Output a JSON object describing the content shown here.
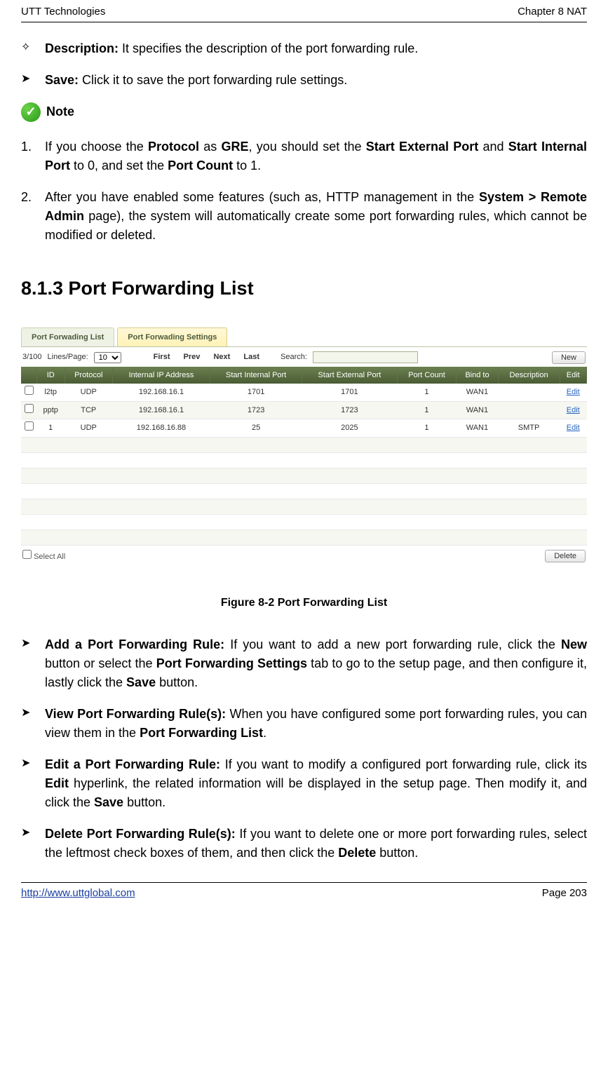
{
  "header": {
    "left": "UTT Technologies",
    "right": "Chapter 8 NAT"
  },
  "bullets_top": [
    {
      "sym": "✧",
      "label": "Description:",
      "text": " It specifies the description of the port forwarding rule."
    },
    {
      "sym": "➤",
      "label": "Save:",
      "text": " Click it to save the port forwarding rule settings."
    }
  ],
  "note": {
    "label": "Note"
  },
  "numbered": [
    {
      "n": "1.",
      "pre": "If you choose the ",
      "b1": "Protocol",
      "mid1": " as ",
      "b2": "GRE",
      "mid2": ", you should set the ",
      "b3": "Start External Port",
      "mid3": " and ",
      "b4": "Start Internal Port",
      "mid4": " to 0, and set the ",
      "b5": "Port Count",
      "post": " to 1."
    },
    {
      "n": "2.",
      "pre": "After you have enabled some features (such as, HTTP management in the ",
      "b1": "System > Remote Admin",
      "post": " page), the system will automatically create some port forwarding rules, which cannot be modified or deleted."
    }
  ],
  "section_heading": "8.1.3    Port Forwarding List",
  "shot": {
    "tabs": {
      "inactive": "Port Forwading List",
      "active": "Port Forwading Settings"
    },
    "toolbar": {
      "counter": "3/100",
      "lpp_label": "Lines/Page:",
      "lpp_value": "10",
      "first": "First",
      "prev": "Prev",
      "next": "Next",
      "last": "Last",
      "search_label": "Search:",
      "new_btn": "New"
    },
    "columns": {
      "ck": "",
      "id": "ID",
      "proto": "Protocol",
      "ip": "Internal IP Address",
      "sip": "Start Internal Port",
      "sep": "Start External Port",
      "pc": "Port Count",
      "bind": "Bind to",
      "desc": "Description",
      "edit": "Edit"
    },
    "rows": [
      {
        "id": "l2tp",
        "proto": "UDP",
        "ip": "192.168.16.1",
        "sip": "1701",
        "sep": "1701",
        "pc": "1",
        "bind": "WAN1",
        "desc": "",
        "edit": "Edit"
      },
      {
        "id": "pptp",
        "proto": "TCP",
        "ip": "192.168.16.1",
        "sip": "1723",
        "sep": "1723",
        "pc": "1",
        "bind": "WAN1",
        "desc": "",
        "edit": "Edit"
      },
      {
        "id": "1",
        "proto": "UDP",
        "ip": "192.168.16.88",
        "sip": "25",
        "sep": "2025",
        "pc": "1",
        "bind": "WAN1",
        "desc": "SMTP",
        "edit": "Edit"
      }
    ],
    "empty_rows": 7,
    "footer": {
      "select_all": "Select All",
      "delete": "Delete"
    }
  },
  "figure_caption": "Figure 8-2 Port Forwarding List",
  "bullets_bottom": [
    {
      "label": "Add a Port Forwarding Rule:",
      "t1": " If you want to add a new port forwarding rule, click the ",
      "b1": "New",
      "t2": " button or select the ",
      "b2": "Port Forwarding Settings",
      "t3": " tab to go to the setup page, and then configure it, lastly click the ",
      "b3": "Save",
      "t4": " button."
    },
    {
      "label": "View Port Forwarding Rule(s):",
      "t1": " When you have configured some port forwarding rules, you can view them in the ",
      "b1": "Port Forwarding List",
      "t2": "."
    },
    {
      "label": "Edit a Port Forwarding Rule:",
      "t1": " If you want to modify a configured port forwarding rule, click its ",
      "b1": "Edit",
      "t2": " hyperlink, the related information will be displayed in the setup page. Then modify it, and click the ",
      "b2": "Save",
      "t3": " button."
    },
    {
      "label": "Delete Port Forwarding Rule(s):",
      "t1": " If you want to delete one or more port forwarding rules, select the leftmost check boxes of them, and then click the ",
      "b1": "Delete",
      "t2": " button."
    }
  ],
  "footer": {
    "url": "http://www.uttglobal.com",
    "page": "Page  203"
  }
}
